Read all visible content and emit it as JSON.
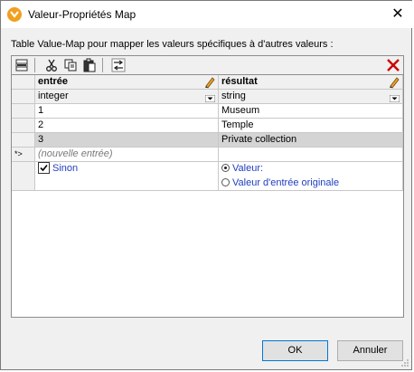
{
  "window": {
    "title": "Valeur-Propriétés Map",
    "close_glyph": "✕"
  },
  "description": "Table  Value-Map pour mapper les valeurs spécifiques à d'autres valeurs :",
  "toolbar": {
    "buttons": [
      "insert-row-icon",
      "cut-icon",
      "copy-icon",
      "paste-icon",
      "swap-columns-icon"
    ],
    "delete_icon": "delete-x-icon"
  },
  "table": {
    "columns": [
      {
        "header": "entrée",
        "type": "integer"
      },
      {
        "header": "résultat",
        "type": "string"
      }
    ],
    "rows": [
      {
        "input": "1",
        "output": "Museum"
      },
      {
        "input": "2",
        "output": "Temple"
      },
      {
        "input": "3",
        "output": "Private collection"
      }
    ],
    "new_row_marker": "*>",
    "new_row_placeholder": "(nouvelle entrée)",
    "otherwise": {
      "label": "Sinon",
      "checked": true,
      "options": [
        {
          "label": "Valeur:",
          "selected": true
        },
        {
          "label": "Valeur d'entrée originale",
          "selected": false
        }
      ]
    }
  },
  "buttons": {
    "ok": "OK",
    "cancel": "Annuler"
  },
  "colors": {
    "accent": "#0078d7",
    "link": "#1f3fbf",
    "delete": "#cc0000",
    "selected_row": "#d4d4d4"
  }
}
